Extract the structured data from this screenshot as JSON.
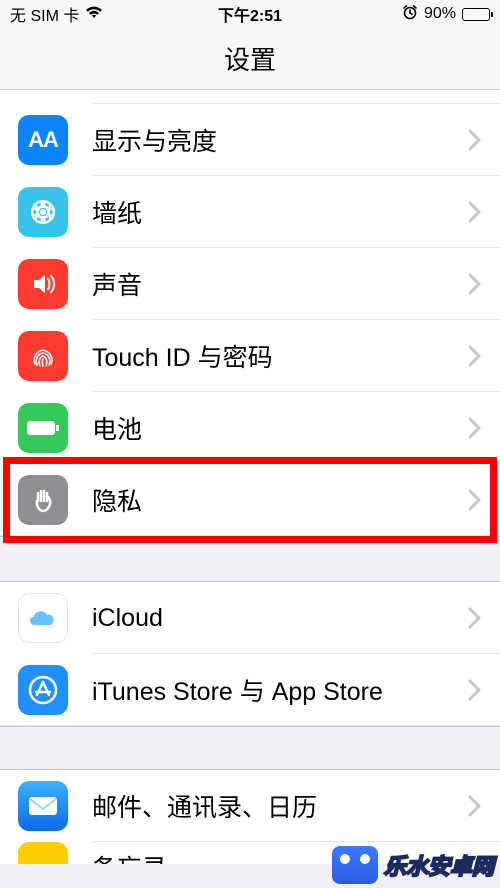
{
  "status": {
    "carrier": "无 SIM 卡",
    "time": "下午2:51",
    "battery_pct": "90%"
  },
  "nav": {
    "title": "设置"
  },
  "groups": [
    {
      "rows": [
        {
          "key": "display",
          "label": "显示与亮度",
          "icon": "display-brightness-icon",
          "bg": "#0a84ff",
          "highlight": false
        },
        {
          "key": "wallpaper",
          "label": "墙纸",
          "icon": "wallpaper-icon",
          "bg": "#35c5e8",
          "highlight": false
        },
        {
          "key": "sound",
          "label": "声音",
          "icon": "sound-icon",
          "bg": "#ff3b30",
          "highlight": false
        },
        {
          "key": "touchid",
          "label": "Touch ID 与密码",
          "icon": "fingerprint-icon",
          "bg": "#ff3b30",
          "highlight": false
        },
        {
          "key": "battery",
          "label": "电池",
          "icon": "battery-icon",
          "bg": "#34c759",
          "highlight": false
        },
        {
          "key": "privacy",
          "label": "隐私",
          "icon": "privacy-hand-icon",
          "bg": "#8e8e93",
          "highlight": true
        }
      ]
    },
    {
      "rows": [
        {
          "key": "icloud",
          "label": "iCloud",
          "icon": "icloud-icon",
          "bg": "#ffffff",
          "highlight": false
        },
        {
          "key": "itunes",
          "label": "iTunes Store 与 App Store",
          "icon": "appstore-icon",
          "bg": "#1e90ff",
          "highlight": false
        }
      ]
    },
    {
      "rows": [
        {
          "key": "mail",
          "label": "邮件、通讯录、日历",
          "icon": "mail-icon",
          "bg": "#1e90ff",
          "highlight": false
        },
        {
          "key": "notes",
          "label": "备忘录",
          "icon": "notes-icon",
          "bg": "#ffcc00",
          "highlight": false
        }
      ]
    }
  ],
  "watermark": "乐水安卓网"
}
